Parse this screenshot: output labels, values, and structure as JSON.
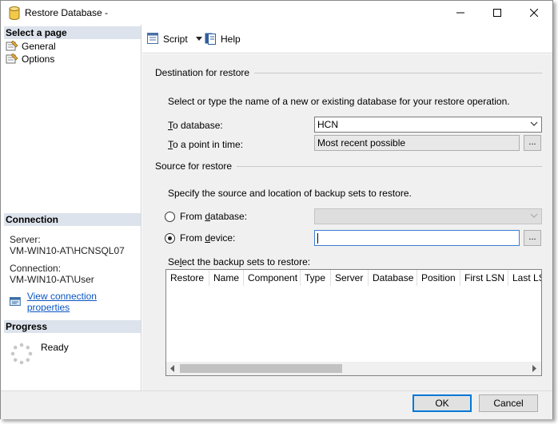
{
  "window": {
    "title": "Restore Database -"
  },
  "left_pane": {
    "select_page": {
      "header": "Select a page",
      "items": [
        {
          "label": "General",
          "icon": "page-icon"
        },
        {
          "label": "Options",
          "icon": "page-icon"
        }
      ]
    },
    "connection": {
      "header": "Connection",
      "server_label": "Server:",
      "server_value": "VM-WIN10-AT\\HCNSQL07",
      "connection_label": "Connection:",
      "connection_value": "VM-WIN10-AT\\User",
      "link_text": "View connection properties"
    },
    "progress": {
      "header": "Progress",
      "status": "Ready"
    }
  },
  "toolbar": {
    "script_label": "Script",
    "help_label": "Help"
  },
  "destination": {
    "group_title": "Destination for restore",
    "description": "Select or type the name of a new or existing database for your restore operation.",
    "to_database_label": "To database:",
    "to_database_value": "HCN",
    "point_in_time_label": "To a point in time:",
    "point_in_time_value": "Most recent possible",
    "ellipsis": "..."
  },
  "source": {
    "group_title": "Source for restore",
    "description": "Specify the source and location of backup sets to restore.",
    "from_database_label": "From database:",
    "from_database_value": "",
    "from_device_label": "From device:",
    "from_device_value": "",
    "selected": "device",
    "ellipsis": "..."
  },
  "backup_sets": {
    "label": "Select the backup sets to restore:",
    "columns": [
      "Restore",
      "Name",
      "Component",
      "Type",
      "Server",
      "Database",
      "Position",
      "First LSN",
      "Last LSN"
    ]
  },
  "footer": {
    "ok_label": "OK",
    "cancel_label": "Cancel"
  },
  "colors": {
    "section_header_bg": "#dde3ec",
    "link": "#0b55c4",
    "focus_border": "#0078d7"
  }
}
